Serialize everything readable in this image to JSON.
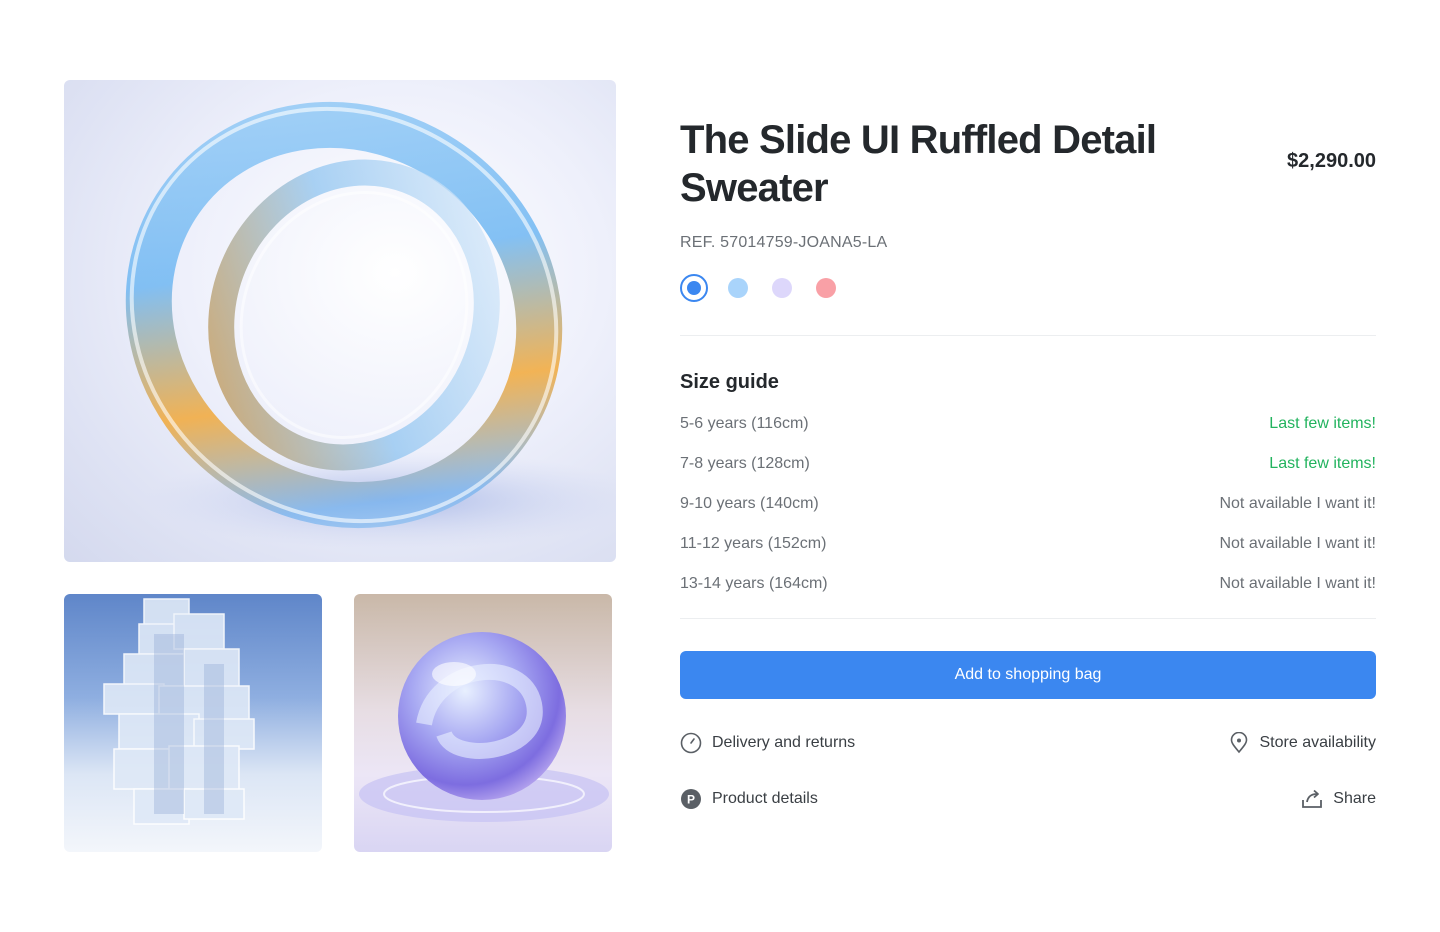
{
  "product": {
    "title": "The Slide UI Ruffled Detail Sweater",
    "price": "$2,290.00",
    "ref": "REF. 57014759-JOANA5-LA"
  },
  "colors": [
    {
      "name": "blue",
      "hex": "#3b87f0",
      "selected": true
    },
    {
      "name": "light-blue",
      "hex": "#a9d4fb",
      "selected": false
    },
    {
      "name": "lavender",
      "hex": "#ddd7fb",
      "selected": false
    },
    {
      "name": "pink",
      "hex": "#f9a0a6",
      "selected": false
    }
  ],
  "size_guide": {
    "title": "Size guide",
    "sizes": [
      {
        "label": "5-6 years (116cm)",
        "status": "Last few items!",
        "available": true
      },
      {
        "label": "7-8 years (128cm)",
        "status": "Last few items!",
        "available": true
      },
      {
        "label": "9-10 years (140cm)",
        "status": "Not available I want it!",
        "available": false
      },
      {
        "label": "11-12 years (152cm)",
        "status": "Not available I want it!",
        "available": false
      },
      {
        "label": "13-14 years (164cm)",
        "status": "Not available I want it!",
        "available": false
      }
    ]
  },
  "cta": {
    "label": "Add to shopping bag"
  },
  "links": {
    "delivery": {
      "label": "Delivery and returns",
      "icon": "clock-icon"
    },
    "store": {
      "label": "Store availability",
      "icon": "location-pin-icon"
    },
    "details": {
      "label": "Product details",
      "icon": "product-p-icon"
    },
    "share": {
      "label": "Share",
      "icon": "share-icon"
    }
  },
  "theme": {
    "accent": "#3b87f0",
    "available": "#22b35e",
    "muted": "#6b7076"
  }
}
